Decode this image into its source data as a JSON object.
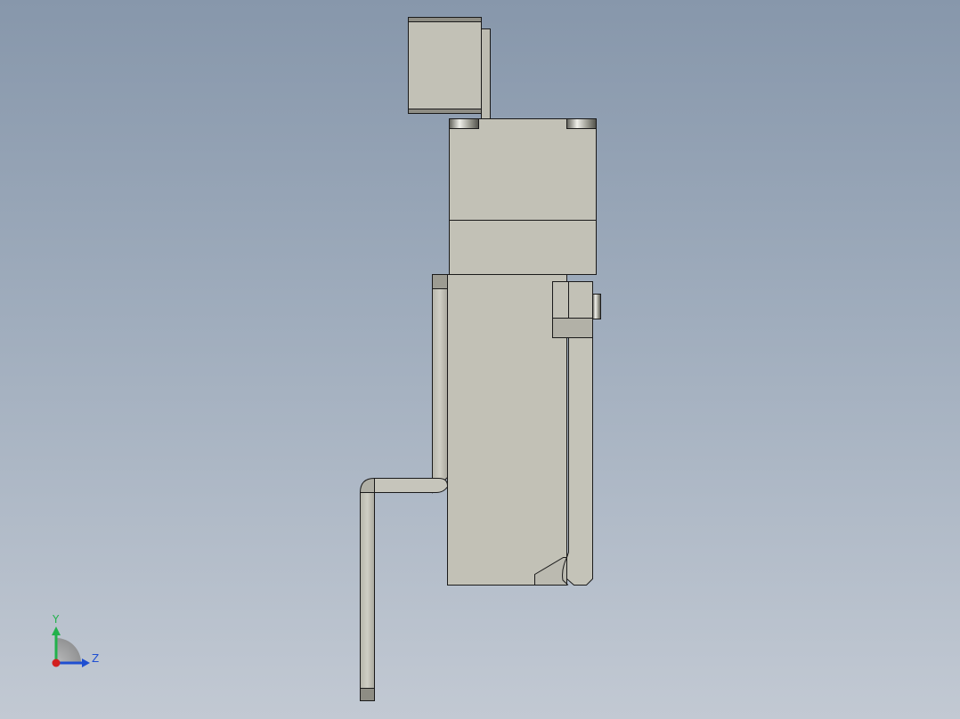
{
  "viewport": {
    "background_top": "#8797ab",
    "background_bottom": "#c2c9d3"
  },
  "model": {
    "face_color": "#c2c1b6",
    "edge_color": "#1a1a1a",
    "highlight_color": "#e6e6df",
    "shadow_color": "#6f6f66"
  },
  "triad": {
    "y_label": "Y",
    "z_label": "Z",
    "y_color": "#22b14c",
    "z_color": "#1f4fd1",
    "x_color": "#d21f1f",
    "icon": "view-orientation-triad-icon"
  }
}
